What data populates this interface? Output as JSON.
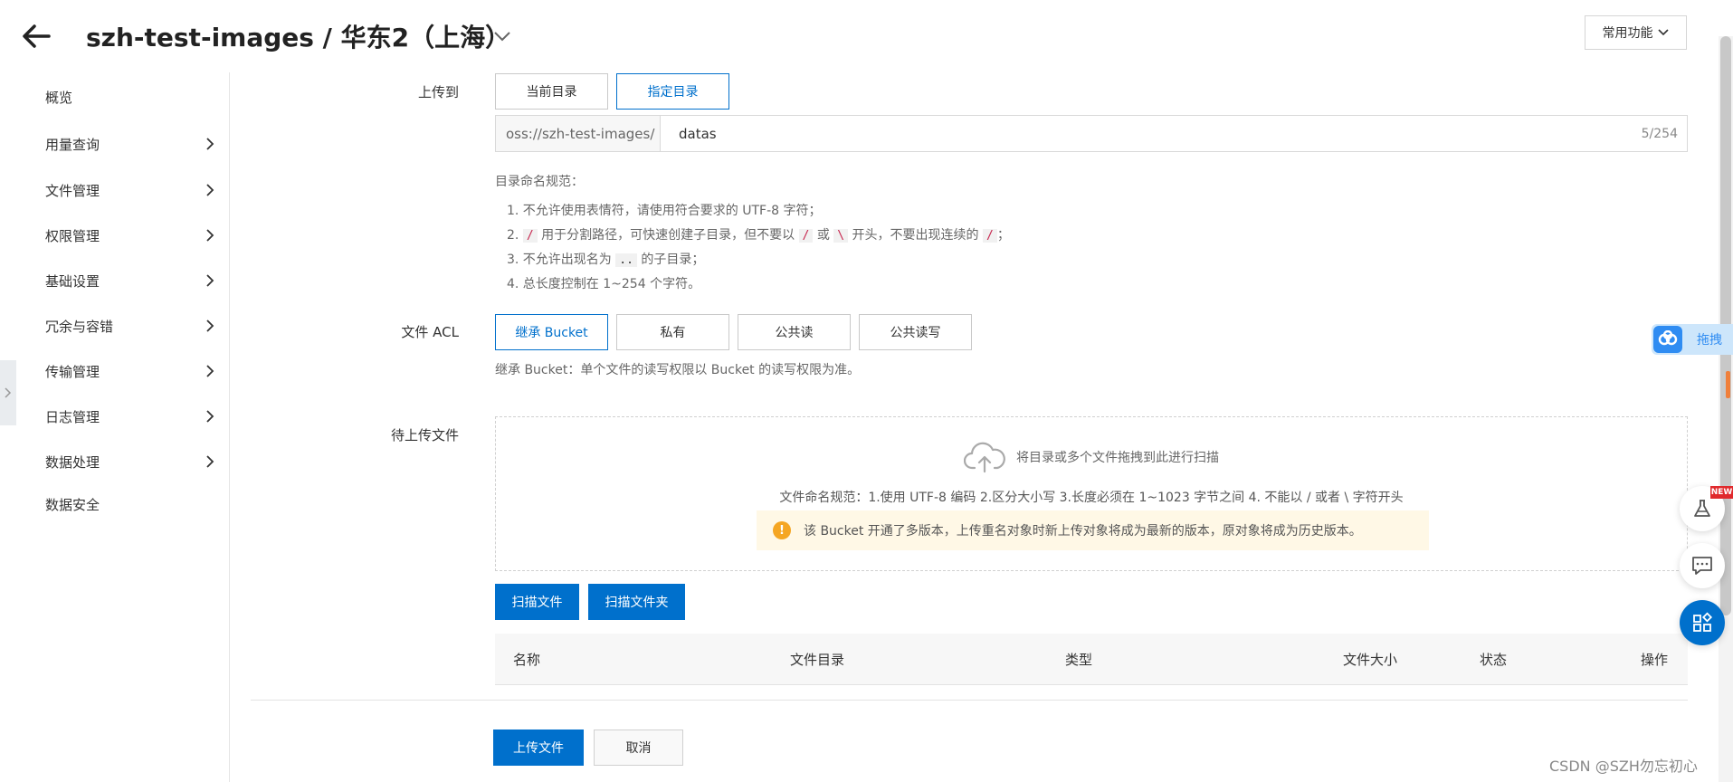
{
  "header": {
    "title": "szh-test-images / 华东2（上海）",
    "common_functions": "常用功能"
  },
  "sidebar": {
    "items": [
      {
        "label": "概览"
      },
      {
        "label": "用量查询"
      },
      {
        "label": "文件管理"
      },
      {
        "label": "权限管理"
      },
      {
        "label": "基础设置"
      },
      {
        "label": "冗余与容错"
      },
      {
        "label": "传输管理"
      },
      {
        "label": "日志管理"
      },
      {
        "label": "数据处理"
      },
      {
        "label": "数据安全"
      }
    ]
  },
  "upload_to": {
    "label": "上传到",
    "options": [
      "当前目录",
      "指定目录"
    ],
    "selected": "指定目录",
    "path_prefix": "oss://szh-test-images/",
    "path_value": "datas",
    "char_count": "5/254"
  },
  "dir_rules": {
    "title": "目录命名规范：",
    "r1": "1. 不允许使用表情符，请使用符合要求的 UTF-8 字符；",
    "r2_a": "2. ",
    "r2_t1": "/",
    "r2_b": " 用于分割路径，可快速创建子目录，但不要以 ",
    "r2_t2": "/",
    "r2_c": " 或 ",
    "r2_t3": "\\",
    "r2_d": " 开头，不要出现连续的 ",
    "r2_t4": "/",
    "r2_e": "；",
    "r3_a": "3. 不允许出现名为 ",
    "r3_t": "..",
    "r3_b": " 的子目录；",
    "r4": "4. 总长度控制在 1~254 个字符。"
  },
  "acl": {
    "label": "文件 ACL",
    "options": [
      "继承 Bucket",
      "私有",
      "公共读",
      "公共读写"
    ],
    "selected": "继承 Bucket",
    "note": "继承 Bucket：单个文件的读写权限以 Bucket 的读写权限为准。"
  },
  "pending": {
    "label": "待上传文件",
    "drop_hint": "将目录或多个文件拖拽到此进行扫描",
    "name_rule": "文件命名规范：1.使用 UTF-8 编码 2.区分大小写 3.长度必须在 1~1023 字节之间 4. 不能以 / 或者 \\ 字符开头",
    "warning": "该 Bucket 开通了多版本，上传重名对象时新上传对象将成为最新的版本，原对象将成为历史版本。",
    "scan_files": "扫描文件",
    "scan_folder": "扫描文件夹"
  },
  "table": {
    "columns": [
      "名称",
      "文件目录",
      "类型",
      "文件大小",
      "状态",
      "操作"
    ]
  },
  "footer": {
    "upload": "上传文件",
    "cancel": "取消"
  },
  "floating": {
    "new_badge": "NEW",
    "baidu_text": "拖拽"
  },
  "watermark": "CSDN @SZH勿忘初心",
  "colors": {
    "primary": "#0070cc",
    "warning": "#f5a623",
    "warning_bg": "#fff8e6",
    "badge": "#e0292c"
  }
}
